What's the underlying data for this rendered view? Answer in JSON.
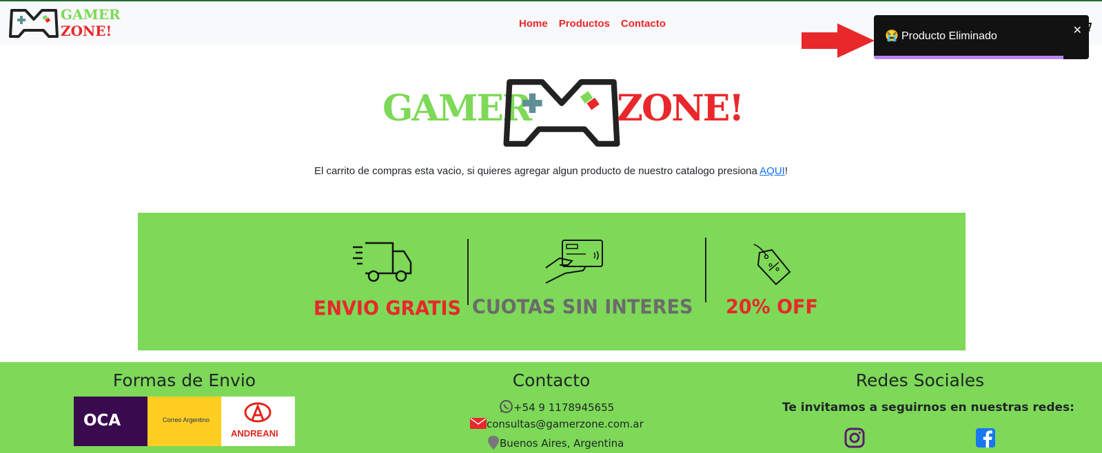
{
  "navbar": {
    "logo_line1": "GAMER",
    "logo_line2": "ZONE!",
    "links": [
      "Home",
      "Productos",
      "Contacto"
    ]
  },
  "toast": {
    "emoji": "😭",
    "message": "Producto Eliminado",
    "close": "✕",
    "progress_fraction": 0.88
  },
  "hero": {
    "word1": "GAMER",
    "word2": "ZONE!",
    "empty_message": "El carrito de compras esta vacio, si quieres agregar algun producto de nuestro catalogo presiona ",
    "link_text": "AQUI",
    "suffix": "!"
  },
  "benefits": [
    {
      "title": "ENVIO GRATIS",
      "icon": "truck-icon",
      "color": "#e8282b"
    },
    {
      "title": "CUOTAS SIN INTERES",
      "icon": "credit-card-icon",
      "color": "#6b6b6b"
    },
    {
      "title": "20% OFF",
      "icon": "price-tag-icon",
      "color": "#e8282b"
    }
  ],
  "footer": {
    "shipping_title": "Formas de Envio",
    "carriers": [
      "OCA",
      "Correo Argentino",
      "ANDREANI"
    ],
    "contact_title": "Contacto",
    "phone": "+54 9 1178945655",
    "email": "consultas@gamerzone.com.ar",
    "location": "Buenos Aires, Argentina",
    "social_title": "Redes Sociales",
    "social_text": "Te invitamos a seguirnos en nuestras redes:"
  },
  "colors": {
    "green": "#7dd957",
    "red": "#e8282b",
    "toast_bg": "#121212",
    "toast_progress": "#bb86fc"
  }
}
